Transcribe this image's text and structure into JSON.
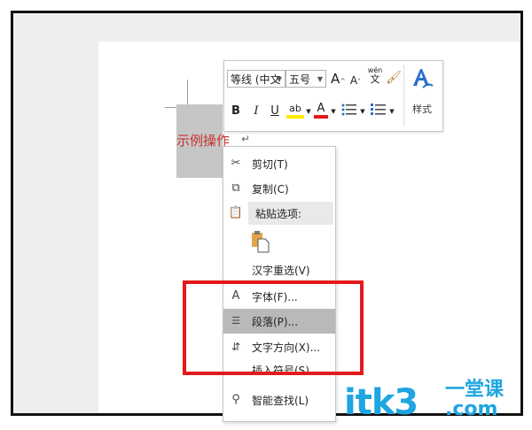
{
  "document": {
    "text": "示例操作",
    "paragraph_mark": "↵"
  },
  "mini_toolbar": {
    "font_name": "等线 (中文",
    "font_size": "五号",
    "grow_font": "A",
    "shrink_font": "A",
    "phonetic": "wén",
    "format_painter": "🖌",
    "bold": "B",
    "italic": "I",
    "underline": "U",
    "highlight": "ab",
    "font_color": "A",
    "styles_label": "样式",
    "colors": {
      "highlight": "#ffea00",
      "font_color": "#e5191b",
      "styles_icon": "#2a6fc9"
    }
  },
  "context_menu": {
    "items": [
      {
        "label": "剪切(T)",
        "icon": "scissors-icon"
      },
      {
        "label": "复制(C)",
        "icon": "copy-icon"
      },
      {
        "label": "粘贴选项:",
        "icon": "paste-icon"
      },
      {
        "label": "汉字重选(V)",
        "icon": ""
      },
      {
        "label": "字体(F)...",
        "icon": "font-icon"
      },
      {
        "label": "段落(P)...",
        "icon": "paragraph-icon"
      },
      {
        "label": "文字方向(X)...",
        "icon": "text-direction-icon"
      },
      {
        "label": "插入符号(S)",
        "icon": ""
      },
      {
        "label": "智能查找(L)",
        "icon": "smart-lookup-icon"
      }
    ]
  },
  "annotation": {
    "color": "#e5191b"
  },
  "watermark": {
    "main": "itk3",
    "sub_top": "一堂课",
    "sub_bottom": ".com",
    "color": "#1fa5e1"
  }
}
